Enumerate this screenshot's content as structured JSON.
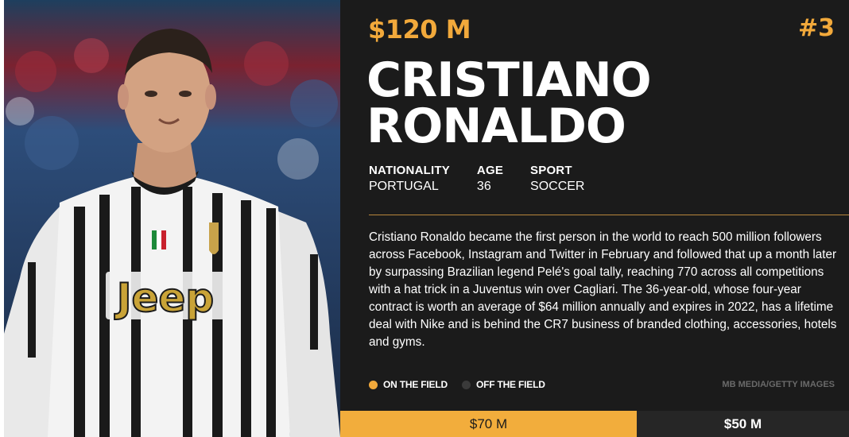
{
  "profile": {
    "earnings_total": "$120 M",
    "rank": "#3",
    "name_line1": "CRISTIANO",
    "name_line2": "RONALDO",
    "facts": [
      {
        "label": "NATIONALITY",
        "value": "PORTUGAL"
      },
      {
        "label": "AGE",
        "value": "36"
      },
      {
        "label": "SPORT",
        "value": "SOCCER"
      }
    ],
    "bio": "Cristiano Ronaldo became the first person in the world to reach 500 million followers across Facebook, Instagram and Twitter in February and followed that up a month later by surpassing Brazilian legend Pelé's goal tally, reaching 770 across all competitions with a hat trick in a Juventus win over Cagliari. The 36-year-old, whose four-year contract is worth an average of $64 million annually and expires in 2022, has a lifetime deal with Nike and is behind the CR7 business of branded clothing, accessories, hotels and gyms.",
    "photo_credit": "MB MEDIA/GETTY IMAGES",
    "jersey_sponsor": "Jeep"
  },
  "legend": {
    "on_field_label": "ON THE FIELD",
    "off_field_label": "OFF THE FIELD"
  },
  "earnings_split": {
    "on_field": {
      "label": "$70 M",
      "value": 70
    },
    "off_field": {
      "label": "$50 M",
      "value": 50
    }
  },
  "colors": {
    "accent": "#f2a93b",
    "panel_bg": "#1b1b1b",
    "off_field_dot": "#3a3a3a"
  }
}
